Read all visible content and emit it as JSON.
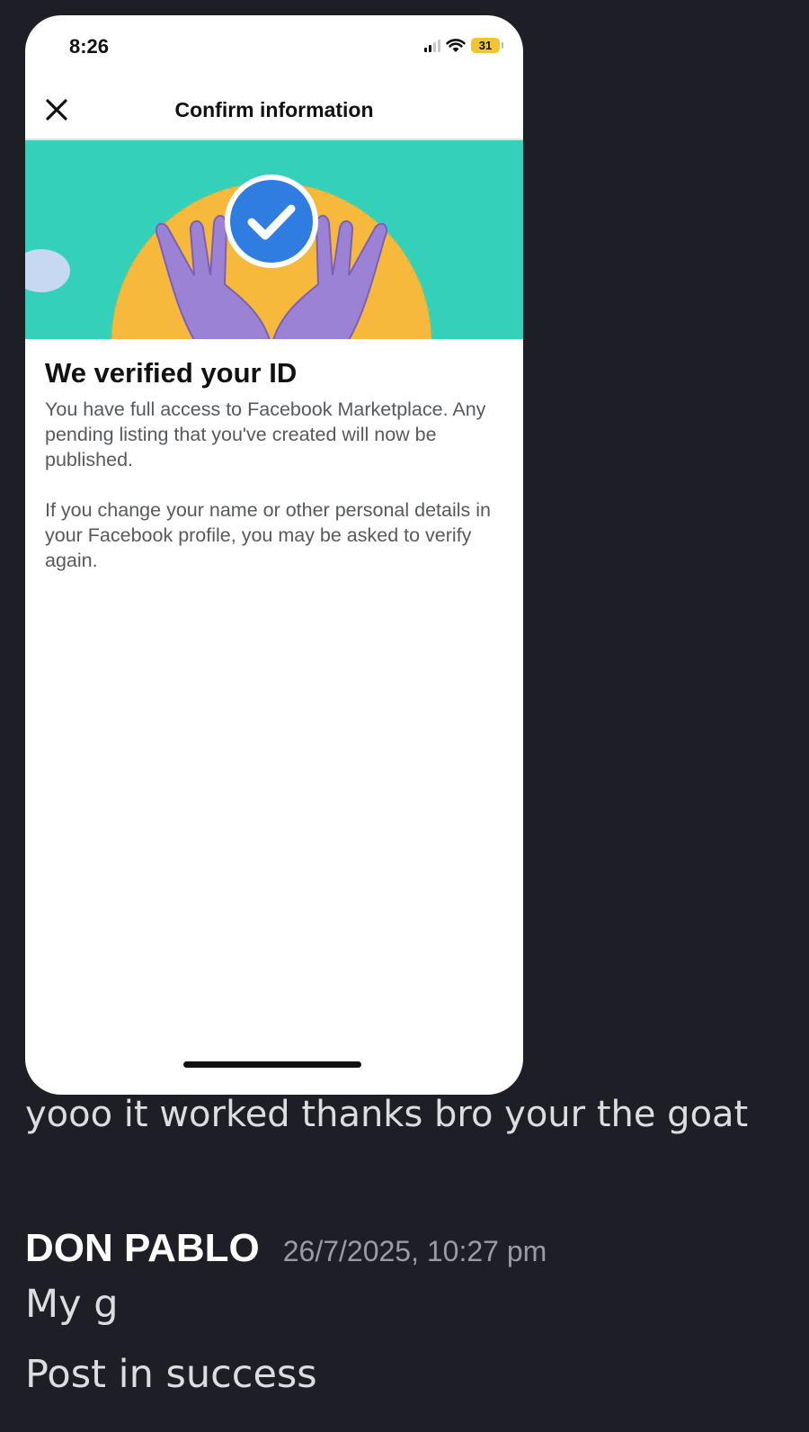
{
  "phone": {
    "status": {
      "time": "8:26",
      "battery": "31"
    },
    "header": {
      "title": "Confirm information"
    },
    "verification": {
      "heading": "We verified your ID",
      "paragraph1": "You have full access to Facebook Marketplace. Any pending listing that you've created will now be published.",
      "paragraph2": "If you change your name or other personal details in your Facebook profile, you may be asked to verify again."
    },
    "icons": [
      "close-icon",
      "signal-icon",
      "wifi-icon",
      "battery-icon",
      "checkmark-icon"
    ]
  },
  "chat": {
    "message1": "yooo it worked thanks bro your the goat",
    "author": "DON PABLO",
    "timestamp": "26/7/2025, 10:27 pm",
    "message2": "My g",
    "message3": "Post in success"
  },
  "colors": {
    "background": "#1e1f26",
    "banner": "#33d1b9",
    "sun": "#f6b93b",
    "hands": "#9b82d4",
    "badge": "#2f7de1",
    "battery": "#f4c430"
  }
}
